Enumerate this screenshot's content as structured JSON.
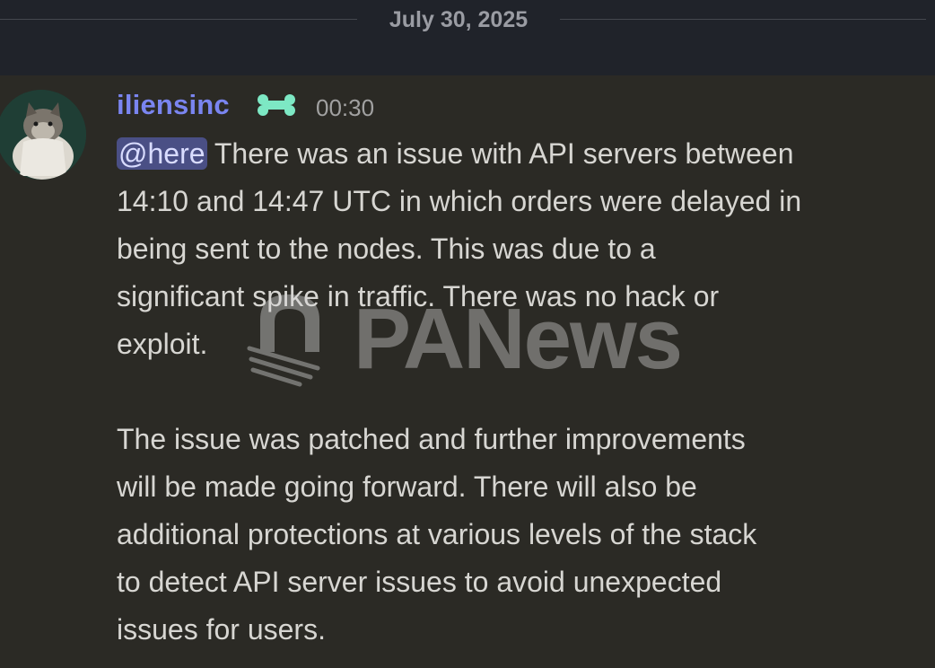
{
  "date_divider": {
    "label": "July 30, 2025"
  },
  "message": {
    "author": "iliensinc",
    "author_color": "#7a85f0",
    "badge_icon": "bone-badge-icon",
    "timestamp": "00:30",
    "mention": "@here",
    "paragraph1_lines": [
      " There was an issue with API servers between",
      "14:10 and 14:47 UTC in which orders were delayed in",
      "being sent to the nodes. This was due to a",
      "significant spike in traffic. There was no hack or",
      "exploit."
    ],
    "paragraph2_lines": [
      "The issue was patched and further improvements",
      "will be made going forward. There will also be",
      "additional protections at various levels of the stack",
      "to detect API server issues to avoid unexpected",
      "issues for users."
    ]
  },
  "watermark": {
    "text": "PANews"
  }
}
